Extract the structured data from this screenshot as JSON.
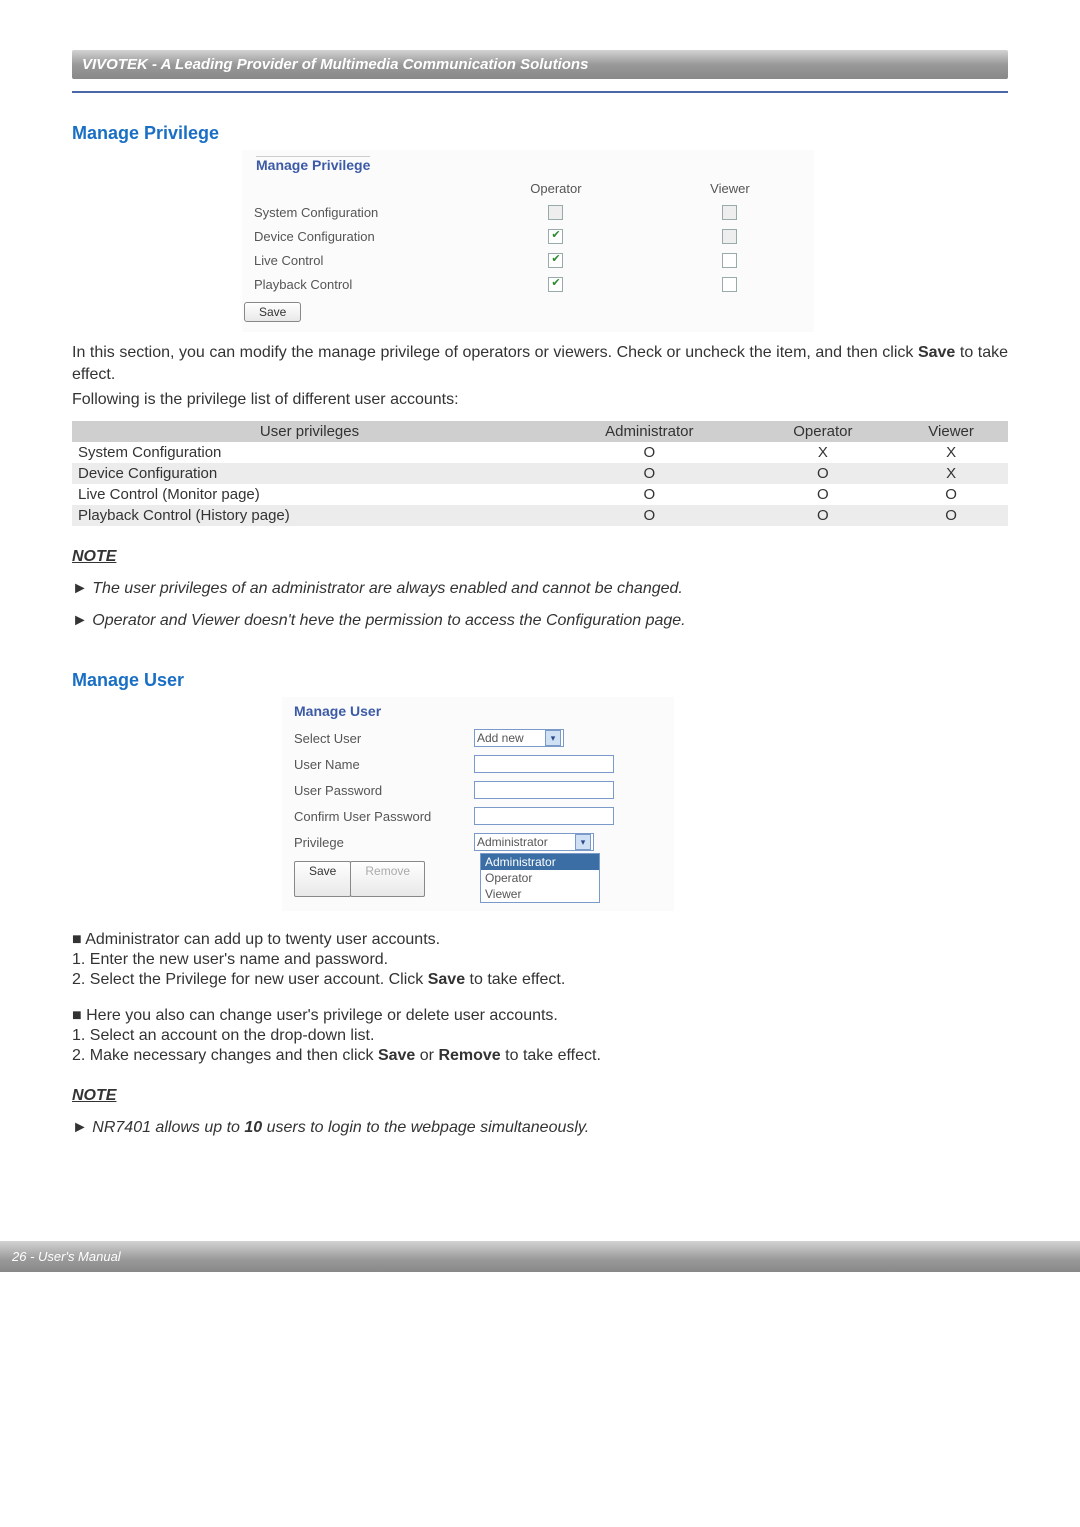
{
  "header": "VIVOTEK - A Leading Provider of Multimedia Communication Solutions",
  "section1_title": "Manage Privilege",
  "priv_panel": {
    "legend": "Manage Privilege",
    "col_operator": "Operator",
    "col_viewer": "Viewer",
    "rows": [
      {
        "label": "System Configuration",
        "op_checked": false,
        "op_disabled": true,
        "vw_checked": false,
        "vw_disabled": true
      },
      {
        "label": "Device Configuration",
        "op_checked": true,
        "op_disabled": false,
        "vw_checked": false,
        "vw_disabled": true
      },
      {
        "label": "Live Control",
        "op_checked": true,
        "op_disabled": false,
        "vw_checked": false,
        "vw_disabled": false
      },
      {
        "label": "Playback Control",
        "op_checked": true,
        "op_disabled": false,
        "vw_checked": false,
        "vw_disabled": false
      }
    ],
    "save": "Save"
  },
  "para1a": "In this section, you can modify the manage privilege of operators or viewers. Check or uncheck the item, and then click ",
  "para1_save": "Save",
  "para1b": " to take effect.",
  "para2": "Following is the privilege list of different user accounts:",
  "table": {
    "h1": "User privileges",
    "h2": "Administrator",
    "h3": "Operator",
    "h4": "Viewer",
    "rows": [
      {
        "c1": "System Configuration",
        "c2": "O",
        "c3": "X",
        "c4": "X"
      },
      {
        "c1": "Device Configuration",
        "c2": "O",
        "c3": "O",
        "c4": "X"
      },
      {
        "c1": "Live Control (Monitor page)",
        "c2": "O",
        "c3": "O",
        "c4": "O"
      },
      {
        "c1": "Playback Control (History page)",
        "c2": "O",
        "c3": "O",
        "c4": "O"
      }
    ]
  },
  "note_heading": "NOTE",
  "note1": "► The user privileges of an administrator are always enabled and cannot be changed.",
  "note2": "► Operator and Viewer doesn't heve the permission to access the Configuration page.",
  "section2_title": "Manage User",
  "user_panel": {
    "legend": "Manage User",
    "select_user_label": "Select User",
    "select_user_value": "Add new",
    "user_name_label": "User Name",
    "user_password_label": "User Password",
    "confirm_pw_label": "Confirm User Password",
    "privilege_label": "Privilege",
    "privilege_value": "Administrator",
    "options": {
      "o1": "Administrator",
      "o2": "Operator",
      "o3": "Viewer"
    },
    "save": "Save",
    "remove": "Remove"
  },
  "blockA": {
    "l1": "■ Administrator can add up to twenty user accounts.",
    "l2": "1. Enter the new user's name and password.",
    "l3a": "2. Select the Privilege for new user account. Click ",
    "l3_save": "Save",
    "l3b": " to take effect."
  },
  "blockB": {
    "l1": "■ Here you also can change user's privilege or delete user accounts.",
    "l2": "1. Select an account on the drop-down list.",
    "l3a": "2. Make necessary changes and then click ",
    "l3_save": "Save",
    "l3_or": " or ",
    "l3_remove": "Remove",
    "l3b": " to take effect."
  },
  "note3a": "► NR7401 allows up to ",
  "note3_num": "10",
  "note3b": " users to login to the webpage simultaneously.",
  "footer": "26 - User's Manual"
}
